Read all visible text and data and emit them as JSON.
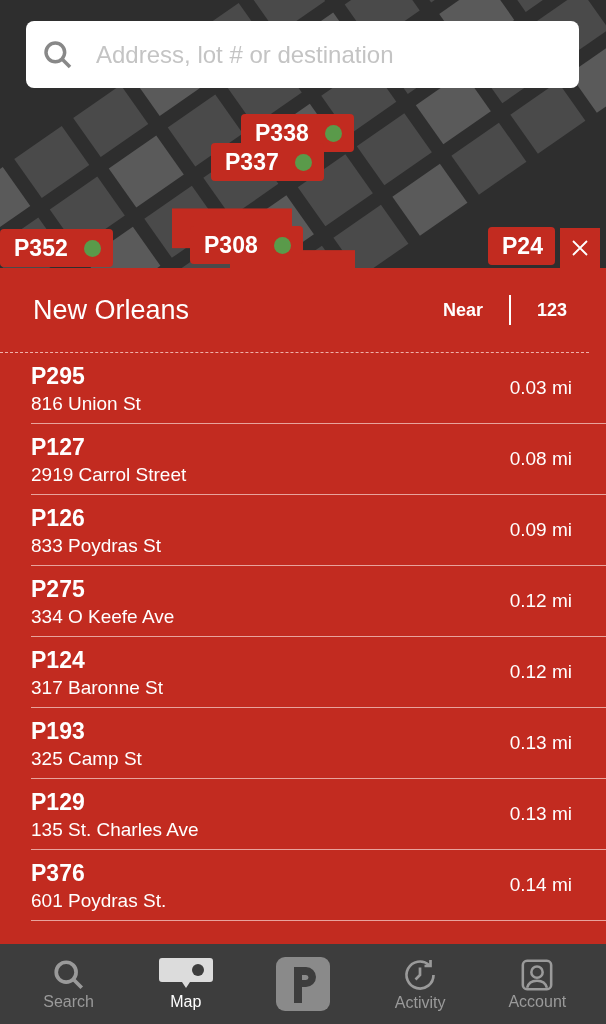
{
  "search": {
    "placeholder": "Address, lot # or destination"
  },
  "markers": [
    {
      "label": "P338"
    },
    {
      "label": "P337"
    },
    {
      "label": "P352"
    },
    {
      "label": "P308"
    },
    {
      "label": "P24"
    }
  ],
  "panel": {
    "title": "New Orleans",
    "sort_options": [
      "Near",
      "123"
    ]
  },
  "lots": [
    {
      "name": "P295",
      "address": "816 Union St",
      "distance": "0.03 mi"
    },
    {
      "name": "P127",
      "address": "2919 Carrol Street",
      "distance": "0.08 mi"
    },
    {
      "name": "P126",
      "address": "833 Poydras St",
      "distance": "0.09 mi"
    },
    {
      "name": "P275",
      "address": "334 O Keefe Ave",
      "distance": "0.12 mi"
    },
    {
      "name": "P124",
      "address": "317 Baronne St",
      "distance": "0.12 mi"
    },
    {
      "name": "P193",
      "address": "325 Camp St",
      "distance": "0.13 mi"
    },
    {
      "name": "P129",
      "address": "135 St. Charles Ave",
      "distance": "0.13 mi"
    },
    {
      "name": "P376",
      "address": "601 Poydras St.",
      "distance": "0.14 mi"
    }
  ],
  "tabs": [
    {
      "kind": "search",
      "label": "Search",
      "selected": false
    },
    {
      "kind": "map",
      "label": "Map",
      "selected": true
    },
    {
      "kind": "park",
      "selected": false
    },
    {
      "kind": "activity",
      "label": "Activity",
      "selected": false
    },
    {
      "kind": "account",
      "label": "Account",
      "selected": false
    }
  ]
}
